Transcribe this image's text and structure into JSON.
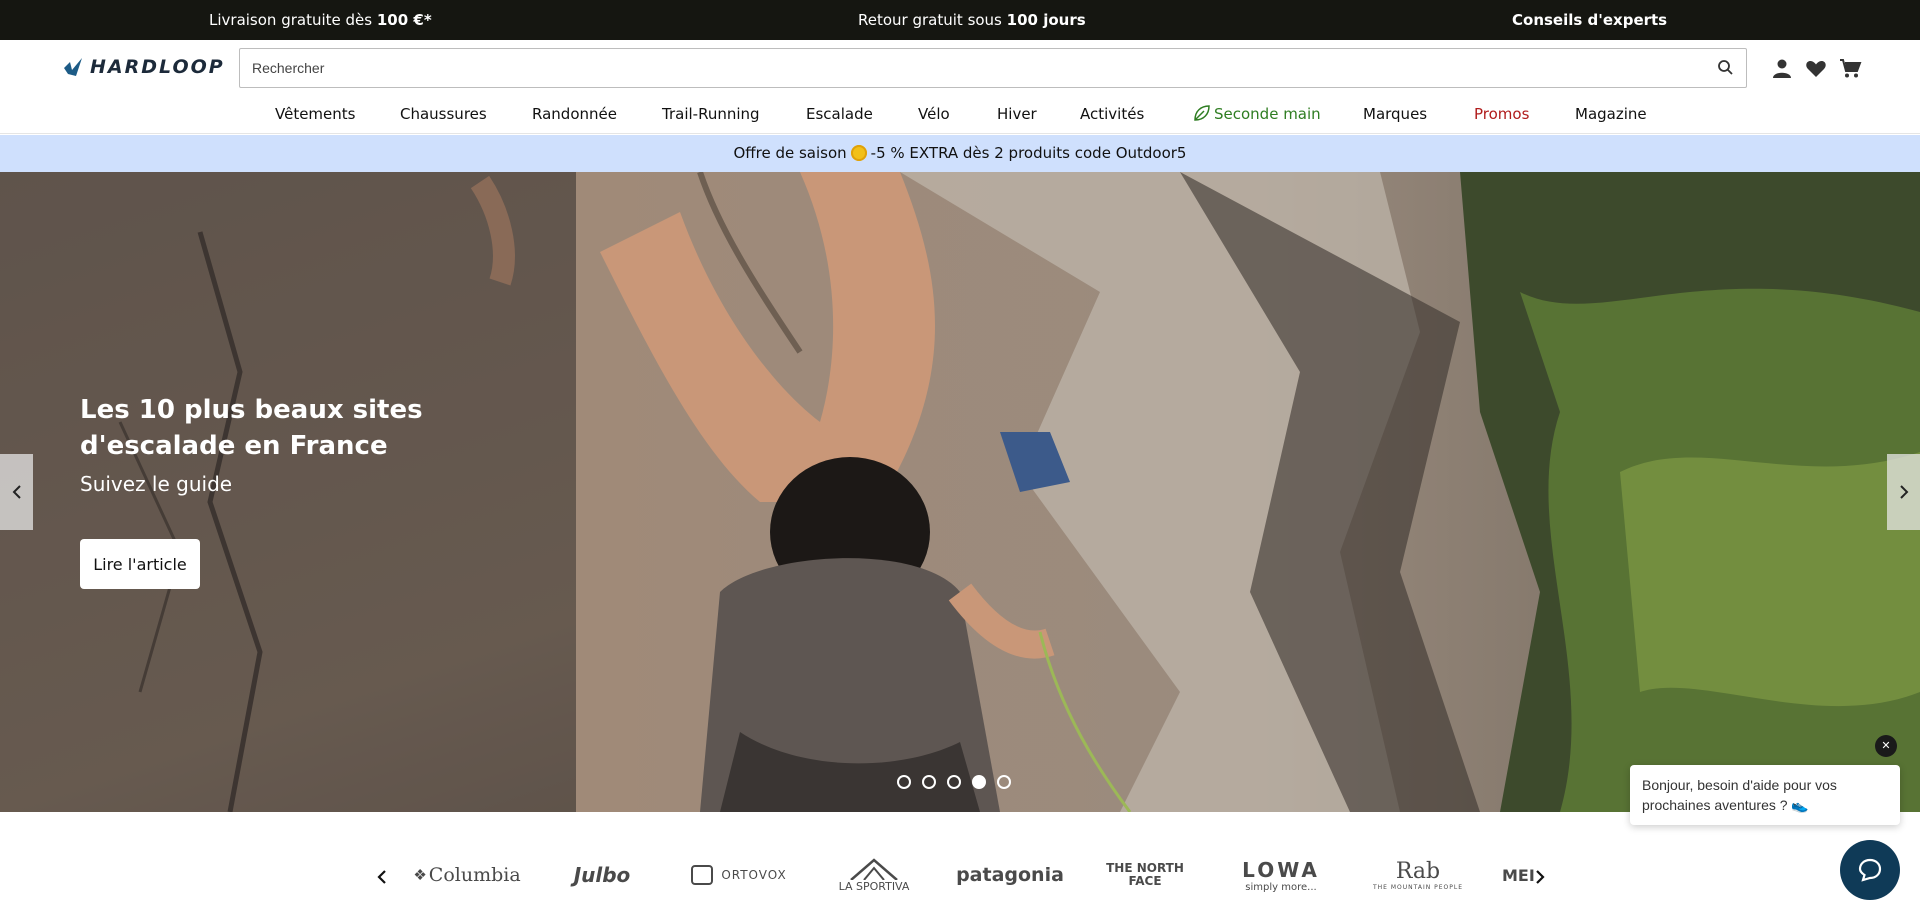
{
  "topbar": {
    "shipping_prefix": "Livraison gratuite dès ",
    "shipping_bold": "100 €*",
    "return_prefix": "Retour gratuit sous ",
    "return_bold": "100 jours",
    "experts": "Conseils d'experts"
  },
  "header": {
    "logo": "HARDLOOP",
    "search_placeholder": "Rechercher"
  },
  "nav": {
    "items": [
      "Vêtements",
      "Chaussures",
      "Randonnée",
      "Trail-Running",
      "Escalade",
      "Vélo",
      "Hiver",
      "Activités",
      "Seconde main",
      "Marques",
      "Promos",
      "Magazine"
    ]
  },
  "promo": {
    "prefix": "Offre de saison",
    "suffix": "-5 % EXTRA dès 2 produits code Outdoor5"
  },
  "hero": {
    "title": "Les 10 plus beaux sites d'escalade en France",
    "subtitle": "Suivez le guide",
    "cta": "Lire l'article",
    "slides": 5,
    "active_slide": 4
  },
  "chat": {
    "message": "Bonjour, besoin d'aide pour vos prochaines aventures ? 👟",
    "close": "✕"
  },
  "brands": {
    "items": [
      "Columbia",
      "Julbo",
      "ORTOVOX",
      "LA SPORTIVA",
      "patagonia",
      "THE NORTH FACE",
      "LOWA",
      "simply more...",
      "Rab",
      "THE MOUNTAIN PEOPLE",
      "MEI"
    ]
  },
  "colors": {
    "topbar_bg": "#151611",
    "promo_bg": "#cfe0fd",
    "seconde_main": "#2f7d22",
    "promos": "#b01c1c",
    "chat_btn": "#0f3a57"
  }
}
